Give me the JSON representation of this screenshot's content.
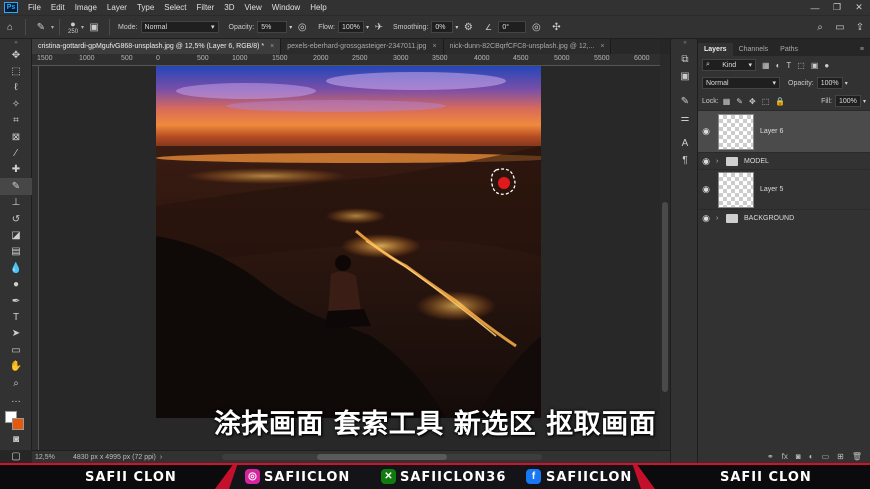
{
  "app": {
    "logo": "Ps"
  },
  "menu": [
    "File",
    "Edit",
    "Image",
    "Layer",
    "Type",
    "Select",
    "Filter",
    "3D",
    "View",
    "Window",
    "Help"
  ],
  "window_controls": [
    "—",
    "❐",
    "✕"
  ],
  "options": {
    "brush_size": "250",
    "mode_label": "Mode:",
    "mode_value": "Normal",
    "opacity_label": "Opacity:",
    "opacity_value": "5%",
    "flow_label": "Flow:",
    "flow_value": "100%",
    "smoothing_label": "Smoothing:",
    "smoothing_value": "0%",
    "angle_value": "0°"
  },
  "tabs": [
    {
      "label": "cristina-gottardi-gpMgufvG868-unsplash.jpg @ 12,5% (Layer 6, RGB/8) *",
      "active": true
    },
    {
      "label": "pexels-eberhard-grossgasteiger-2347011.jpg",
      "active": false
    },
    {
      "label": "nick-dunn-82CBqrfCFC8-unsplash.jpg @ 12,...",
      "active": false
    }
  ],
  "ruler_numbers": [
    "1500",
    "1000",
    "500",
    "0",
    "500",
    "1000",
    "1500",
    "2000",
    "2500",
    "3000",
    "3500",
    "4000",
    "4500",
    "5000",
    "5500",
    "6000"
  ],
  "status": {
    "zoom": "12,5%",
    "doc_size": "4830 px x 4995 px (72 ppi)"
  },
  "layers_panel": {
    "tabs": [
      "Layers",
      "Channels",
      "Paths"
    ],
    "kind_label": "Kind",
    "blend_mode": "Normal",
    "opacity_label": "Opacity:",
    "opacity_value": "100%",
    "lock_label": "Lock:",
    "fill_label": "Fill:",
    "fill_value": "100%",
    "layers": [
      {
        "name": "Layer 6",
        "type": "layer",
        "selected": true
      },
      {
        "name": "MODEL",
        "type": "group",
        "selected": false
      },
      {
        "name": "Layer 5",
        "type": "layer",
        "selected": false
      },
      {
        "name": "BACKGROUND",
        "type": "group",
        "selected": false
      }
    ]
  },
  "subtitle": "涂抹画面 套索工具 新选区 抠取画面",
  "banner": {
    "left_name": "SAFII CLON",
    "instagram": "SAFIICLON",
    "xbox": "SAFIICLON36",
    "facebook": "SAFIICLON",
    "right_name": "SAFII CLON",
    "colors": {
      "red": "#c5102c",
      "instagram": "#d6249f",
      "xbox": "#107c10",
      "facebook": "#1877f2"
    }
  }
}
